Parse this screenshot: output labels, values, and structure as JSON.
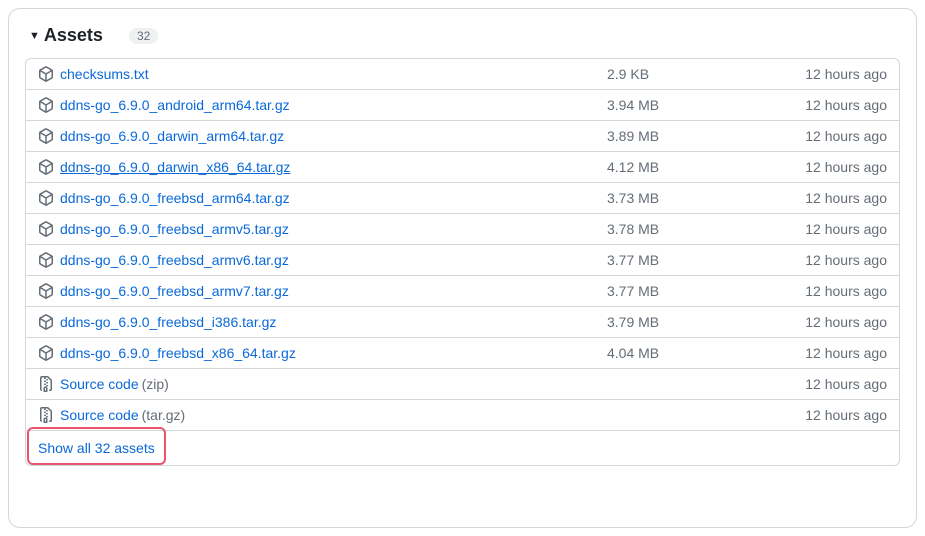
{
  "header": {
    "title": "Assets",
    "count": "32"
  },
  "assets": [
    {
      "icon": "package",
      "name": "checksums.txt",
      "size": "2.9 KB",
      "time": "12 hours ago",
      "underlined": false
    },
    {
      "icon": "package",
      "name": "ddns-go_6.9.0_android_arm64.tar.gz",
      "size": "3.94 MB",
      "time": "12 hours ago",
      "underlined": false
    },
    {
      "icon": "package",
      "name": "ddns-go_6.9.0_darwin_arm64.tar.gz",
      "size": "3.89 MB",
      "time": "12 hours ago",
      "underlined": false
    },
    {
      "icon": "package",
      "name": "ddns-go_6.9.0_darwin_x86_64.tar.gz",
      "size": "4.12 MB",
      "time": "12 hours ago",
      "underlined": true
    },
    {
      "icon": "package",
      "name": "ddns-go_6.9.0_freebsd_arm64.tar.gz",
      "size": "3.73 MB",
      "time": "12 hours ago",
      "underlined": false
    },
    {
      "icon": "package",
      "name": "ddns-go_6.9.0_freebsd_armv5.tar.gz",
      "size": "3.78 MB",
      "time": "12 hours ago",
      "underlined": false
    },
    {
      "icon": "package",
      "name": "ddns-go_6.9.0_freebsd_armv6.tar.gz",
      "size": "3.77 MB",
      "time": "12 hours ago",
      "underlined": false
    },
    {
      "icon": "package",
      "name": "ddns-go_6.9.0_freebsd_armv7.tar.gz",
      "size": "3.77 MB",
      "time": "12 hours ago",
      "underlined": false
    },
    {
      "icon": "package",
      "name": "ddns-go_6.9.0_freebsd_i386.tar.gz",
      "size": "3.79 MB",
      "time": "12 hours ago",
      "underlined": false
    },
    {
      "icon": "package",
      "name": "ddns-go_6.9.0_freebsd_x86_64.tar.gz",
      "size": "4.04 MB",
      "time": "12 hours ago",
      "underlined": false
    },
    {
      "icon": "zip",
      "name": "Source code",
      "format": "(zip)",
      "size": "",
      "time": "12 hours ago",
      "underlined": false
    },
    {
      "icon": "zip",
      "name": "Source code",
      "format": "(tar.gz)",
      "size": "",
      "time": "12 hours ago",
      "underlined": false
    }
  ],
  "show_all": "Show all 32 assets"
}
